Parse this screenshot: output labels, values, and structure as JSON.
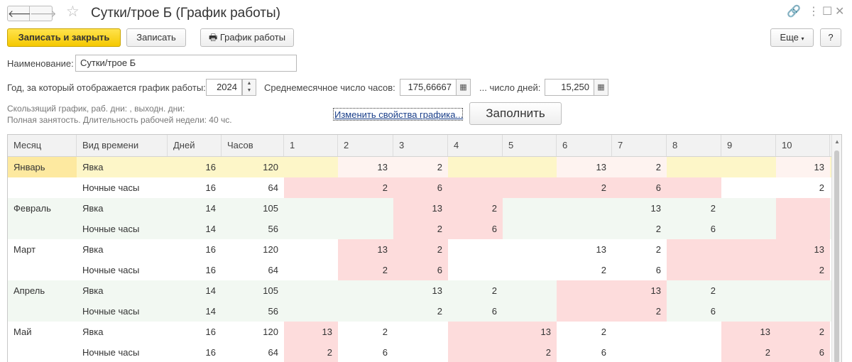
{
  "window": {
    "title": "Сутки/трое Б (График работы)",
    "back_icon": "🡐",
    "forward_icon": "🡒",
    "star_icon": "☆",
    "link_icon": "🔗",
    "more_icon": "⋮",
    "maximize_icon": "☐",
    "close_icon": "✕"
  },
  "toolbar": {
    "save_close_label": "Записать и закрыть",
    "save_label": "Записать",
    "schedule_label": "График работы",
    "printer_icon": "🖶",
    "more_label": "Еще",
    "help_label": "?"
  },
  "form": {
    "name_label": "Наименование:",
    "name_value": "Сутки/трое Б",
    "year_label": "Год, за который отображается график работы:",
    "year_value": "2024",
    "avg_hours_label": "Среднемесячное число часов:",
    "avg_hours_value": "175,66667",
    "days_label": "... число дней:",
    "days_value": "15,250",
    "info_line1": "Скользящий график, раб. дни: , выходн. дни:",
    "info_line2": "Полная занятость. Длительность рабочей недели: 40 чс.",
    "change_link": "Изменить свойства графика...",
    "fill_button": "Заполнить"
  },
  "colors": {
    "workday": "#fddcdc",
    "row_green": "#f2f8f2",
    "row_white": "#ffffff",
    "selected": "#fdf6c8",
    "selected_month": "#fde9a0",
    "selected_pink": "#fef3f0"
  },
  "table": {
    "columns": [
      "Месяц",
      "Вид времени",
      "Дней",
      "Часов",
      "1",
      "2",
      "3",
      "4",
      "5",
      "6",
      "7",
      "8",
      "9",
      "10"
    ],
    "rows": [
      {
        "month": "Январь",
        "type": "Явка",
        "days": "16",
        "hours": "120",
        "vals": [
          "",
          "13",
          "2",
          "",
          "",
          "13",
          "2",
          "",
          "",
          "13"
        ],
        "work": [
          0,
          1,
          1,
          0,
          0,
          1,
          1,
          0,
          0,
          1
        ],
        "bg": "selected"
      },
      {
        "month": "",
        "type": "Ночные часы",
        "days": "16",
        "hours": "64",
        "vals": [
          "",
          "2",
          "6",
          "",
          "",
          "2",
          "6",
          "",
          "",
          "2"
        ],
        "work": [
          1,
          1,
          1,
          1,
          1,
          1,
          1,
          1,
          0,
          0
        ],
        "bg": "white"
      },
      {
        "month": "Февраль",
        "type": "Явка",
        "days": "14",
        "hours": "105",
        "vals": [
          "",
          "",
          "13",
          "2",
          "",
          "",
          "13",
          "2",
          "",
          ""
        ],
        "work": [
          0,
          0,
          1,
          1,
          0,
          0,
          0,
          0,
          0,
          1
        ],
        "bg": "green"
      },
      {
        "month": "",
        "type": "Ночные часы",
        "days": "14",
        "hours": "56",
        "vals": [
          "",
          "",
          "2",
          "6",
          "",
          "",
          "2",
          "6",
          "",
          ""
        ],
        "work": [
          0,
          0,
          1,
          1,
          0,
          0,
          0,
          0,
          0,
          1
        ],
        "bg": "green"
      },
      {
        "month": "Март",
        "type": "Явка",
        "days": "16",
        "hours": "120",
        "vals": [
          "",
          "13",
          "2",
          "",
          "",
          "13",
          "2",
          "",
          "",
          "13"
        ],
        "work": [
          0,
          1,
          1,
          0,
          0,
          0,
          0,
          1,
          1,
          1
        ],
        "bg": "white"
      },
      {
        "month": "",
        "type": "Ночные часы",
        "days": "16",
        "hours": "64",
        "vals": [
          "",
          "2",
          "6",
          "",
          "",
          "2",
          "6",
          "",
          "",
          "2"
        ],
        "work": [
          0,
          1,
          1,
          0,
          0,
          0,
          0,
          1,
          1,
          1
        ],
        "bg": "white"
      },
      {
        "month": "Апрель",
        "type": "Явка",
        "days": "14",
        "hours": "105",
        "vals": [
          "",
          "",
          "13",
          "2",
          "",
          "",
          "13",
          "2",
          "",
          ""
        ],
        "work": [
          0,
          0,
          0,
          0,
          0,
          1,
          1,
          0,
          0,
          0
        ],
        "bg": "green"
      },
      {
        "month": "",
        "type": "Ночные часы",
        "days": "14",
        "hours": "56",
        "vals": [
          "",
          "",
          "2",
          "6",
          "",
          "",
          "2",
          "6",
          "",
          ""
        ],
        "work": [
          0,
          0,
          0,
          0,
          0,
          1,
          1,
          0,
          0,
          0
        ],
        "bg": "green"
      },
      {
        "month": "Май",
        "type": "Явка",
        "days": "16",
        "hours": "120",
        "vals": [
          "13",
          "2",
          "",
          "",
          "13",
          "2",
          "",
          "",
          "13",
          "2"
        ],
        "work": [
          1,
          0,
          0,
          1,
          1,
          0,
          0,
          0,
          1,
          1
        ],
        "bg": "white"
      },
      {
        "month": "",
        "type": "Ночные часы",
        "days": "16",
        "hours": "64",
        "vals": [
          "2",
          "6",
          "",
          "",
          "2",
          "6",
          "",
          "",
          "2",
          "6"
        ],
        "work": [
          1,
          0,
          0,
          1,
          1,
          0,
          0,
          0,
          1,
          1
        ],
        "bg": "white"
      }
    ]
  }
}
